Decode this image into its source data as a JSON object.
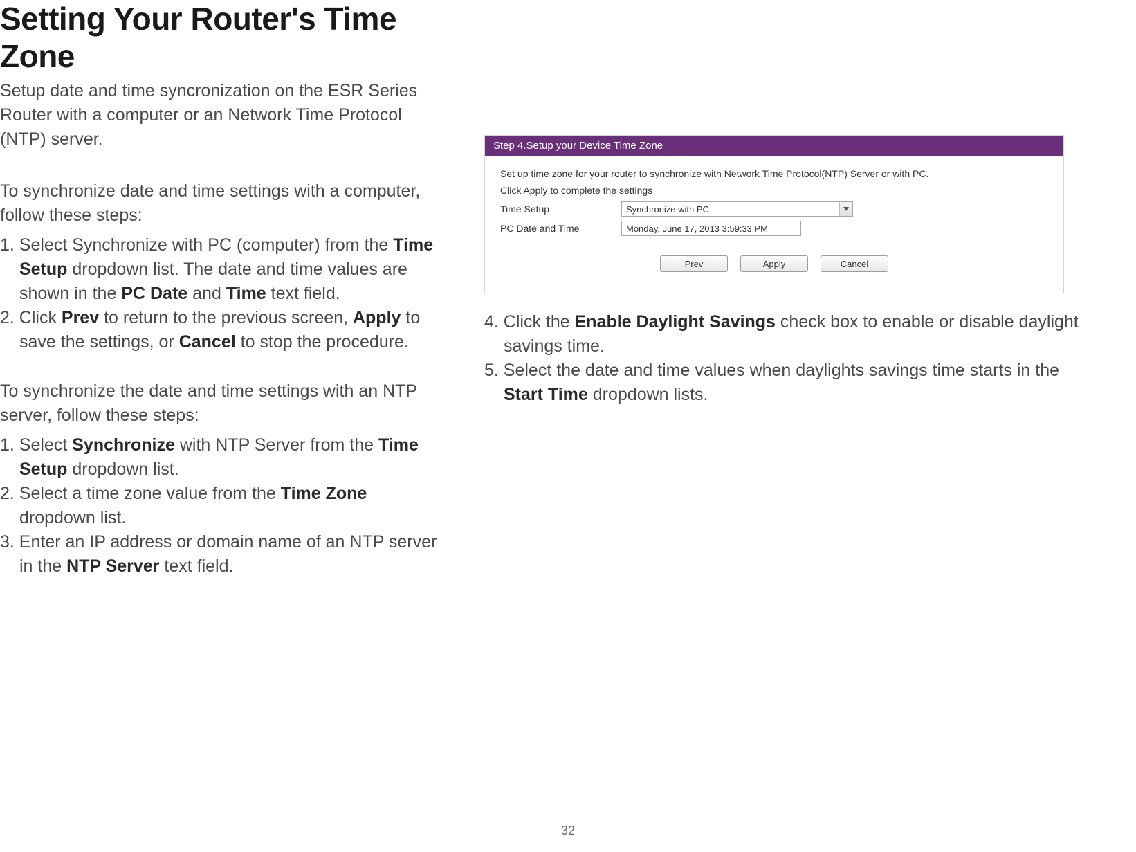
{
  "title": "Setting Your Router's Time Zone",
  "intro": "Setup date and time syncronization on the ESR Series Router with a computer or an Network Time Protocol (NTP) server.",
  "pc_section": {
    "lead": "To synchronize date and time settings with a computer, follow these steps:",
    "step1": {
      "num": "1. ",
      "a": "Select Synchronize with PC (computer) from the ",
      "b1": "Time Setup",
      "c": " dropdown list. The date and time values are shown in the ",
      "b2": "PC Date",
      "d": " and ",
      "b3": "Time",
      "e": " text field."
    },
    "step2": {
      "num": "2. ",
      "a": "Click ",
      "b1": "Prev",
      "c": " to return to the previous screen, ",
      "b2": "Apply",
      "d": " to save the settings, or ",
      "b3": "Cancel",
      "e": " to stop the procedure."
    }
  },
  "ntp_section": {
    "lead": "To synchronize the date and time settings with an NTP server, follow these steps:",
    "step1": {
      "num": "1. ",
      "a": "Select ",
      "b1": "Synchronize",
      "c": " with NTP Server from the ",
      "b2": "Time Setup",
      "d": " dropdown list."
    },
    "step2": {
      "num": "2. ",
      "a": "Select a time zone value from the ",
      "b1": "Time Zone",
      "c": " dropdown list."
    },
    "step3": {
      "num": "3. ",
      "a": "Enter an IP address or domain name of an NTP server in the ",
      "b1": "NTP Server",
      "c": " text field."
    }
  },
  "panel": {
    "header": "Step 4.Setup your Device Time Zone",
    "desc1": "Set up time zone for your router to synchronize with Network Time Protocol(NTP) Server or with PC.",
    "desc2": "Click Apply to complete the settings",
    "time_setup_label": "Time Setup",
    "time_setup_value": "Synchronize with PC",
    "pc_date_label": "PC Date and Time",
    "pc_date_value": "Monday, June 17, 2013 3:59:33 PM",
    "buttons": {
      "prev": "Prev",
      "apply": "Apply",
      "cancel": "Cancel"
    }
  },
  "right_steps": {
    "step4": {
      "num": "4. ",
      "a": "Click the ",
      "b1": "Enable Daylight Savings",
      "c": " check box to enable or disable daylight savings time."
    },
    "step5": {
      "num": "5. ",
      "a": "Select the date and time values when daylights savings time starts in the ",
      "b1": "Start Time",
      "c": " dropdown lists."
    }
  },
  "page_number": "32"
}
